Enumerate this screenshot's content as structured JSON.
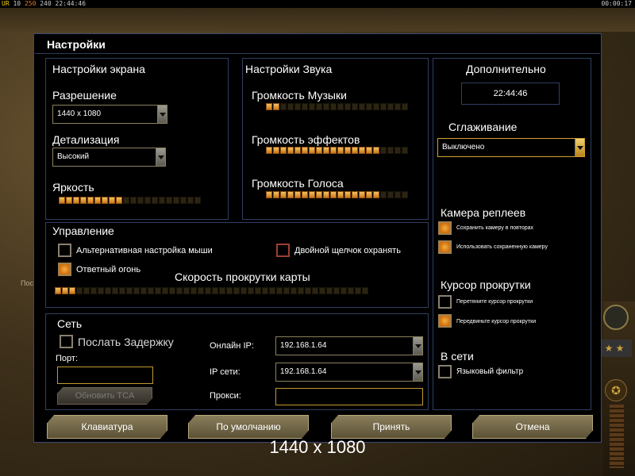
{
  "hud": {
    "left_r": "UR",
    "left_nums": "10",
    "left_o": "250",
    "left_b": "240",
    "time": "22:44:46",
    "right_time": "00:00:17"
  },
  "background": {
    "left_text": "Поср"
  },
  "dialog": {
    "title": "Настройки"
  },
  "screen": {
    "title": "Настройки экрана",
    "resolution_label": "Разрешение",
    "resolution_value": "1440 x 1080",
    "detail_label": "Детализация",
    "detail_value": "Высокий",
    "brightness_label": "Яркость",
    "brightness_level": 9,
    "brightness_total": 20
  },
  "sound": {
    "title": "Настройки Звука",
    "music_label": "Громкость Музыки",
    "music_level": 2,
    "music_total": 20,
    "effects_label": "Громкость эффектов",
    "effects_level": 16,
    "effects_total": 20,
    "voice_label": "Громкость Голоса",
    "voice_level": 16,
    "voice_total": 20
  },
  "control": {
    "title": "Управление",
    "alt_mouse_label": "Альтернативная настройка мыши",
    "alt_mouse_checked": false,
    "double_click_label": "Двойной щелчок охранять",
    "double_click_checked": false,
    "return_fire_label": "Ответный огонь",
    "return_fire_checked": true,
    "scroll_speed_label": "Скорость прокрутки карты",
    "scroll_level": 3,
    "scroll_total": 44
  },
  "network": {
    "title": "Сеть",
    "send_delay_label": "Послать Задержку",
    "send_delay_checked": false,
    "port_label": "Порт:",
    "port_value": "",
    "update_button": "Обновить TCA",
    "online_ip_label": "Онлайн IP:",
    "online_ip_value": "192.168.1.64",
    "lan_ip_label": "IP сети:",
    "lan_ip_value": "192.168.1.64",
    "proxy_label": "Прокси:",
    "proxy_value": ""
  },
  "extra": {
    "title": "Дополнительно",
    "clock": "22:44:46",
    "aa_label": "Сглаживание",
    "aa_value": "Выключено",
    "replay_cam_label": "Камера реплеев",
    "save_cam_label": "Сохранить камеру в повторах",
    "save_cam_checked": true,
    "use_cam_label": "Использовать сохраненную камеру",
    "use_cam_checked": true,
    "scroll_cursor_label": "Курсор прокрутки",
    "drag_cursor_label": "Перетяните курсор прокрутки",
    "drag_cursor_checked": false,
    "move_cursor_label": "Передвиньте курсор прокрутки",
    "move_cursor_checked": true,
    "online_label": "В сети",
    "lang_filter_label": "Языковый фильтр",
    "lang_filter_checked": false
  },
  "buttons": {
    "keyboard": "Клавиатура",
    "defaults": "По умолчанию",
    "accept": "Принять",
    "cancel": "Отмена"
  },
  "footer": {
    "resolution": "1440 x 1080"
  },
  "colors": {
    "accent": "#f0a030",
    "panel_border": "#2f3e62",
    "dialog_bg": "#000000"
  }
}
